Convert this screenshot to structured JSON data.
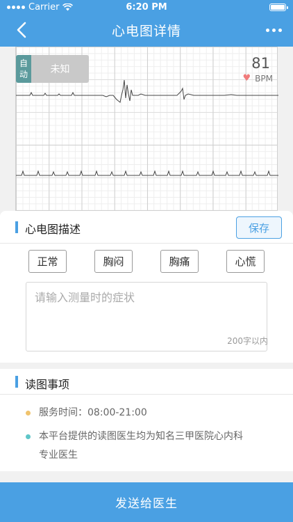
{
  "status": {
    "carrier": "Carrier",
    "time": "6:20 PM"
  },
  "nav": {
    "title": "心电图详情"
  },
  "ecg": {
    "mode_badge": [
      "自",
      "动"
    ],
    "result": "未知",
    "bpm": "81",
    "bpm_unit": "BPM"
  },
  "description": {
    "title": "心电图描述",
    "save_label": "保存",
    "tags": [
      "正常",
      "胸闷",
      "胸痛",
      "心慌"
    ],
    "placeholder": "请输入测量时的症状",
    "limit": "200字以内"
  },
  "reading": {
    "title": "读图事项",
    "items": [
      {
        "text": "服务时间：08:00-21:00",
        "color": "#f0c36d"
      },
      {
        "text": "本平台提供的读图医生均为知名三甲医院心内科",
        "color": "#5fc6c8"
      },
      {
        "text": "专业医生",
        "color": ""
      }
    ]
  },
  "send_label": "发送给医生",
  "colors": {
    "primary": "#4aa0e3",
    "badge": "#5b9a9c",
    "heart": "#f07b7b"
  }
}
